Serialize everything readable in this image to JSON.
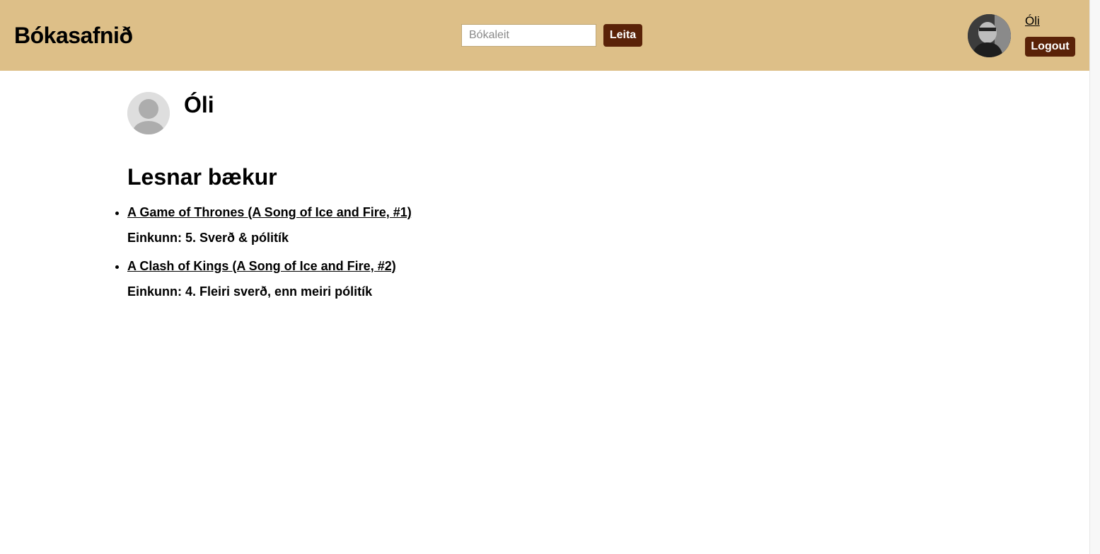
{
  "header": {
    "site_title": "Bókasafnið",
    "search": {
      "placeholder": "Bókaleit",
      "value": "",
      "button_label": "Leita"
    },
    "user": {
      "name_link": "Óli",
      "logout_label": "Logout"
    }
  },
  "profile": {
    "name": "Óli"
  },
  "read_books": {
    "heading": "Lesnar bækur",
    "items": [
      {
        "title": "A Game of Thrones (A Song of Ice and Fire, #1)",
        "review": "Einkunn: 5. Sverð & pólitík"
      },
      {
        "title": "A Clash of Kings (A Song of Ice and Fire, #2)",
        "review": "Einkunn: 4. Fleiri sverð, enn meiri pólitík"
      }
    ]
  },
  "colors": {
    "header_bg": "#ddbf88",
    "button_bg": "#5a2208"
  }
}
